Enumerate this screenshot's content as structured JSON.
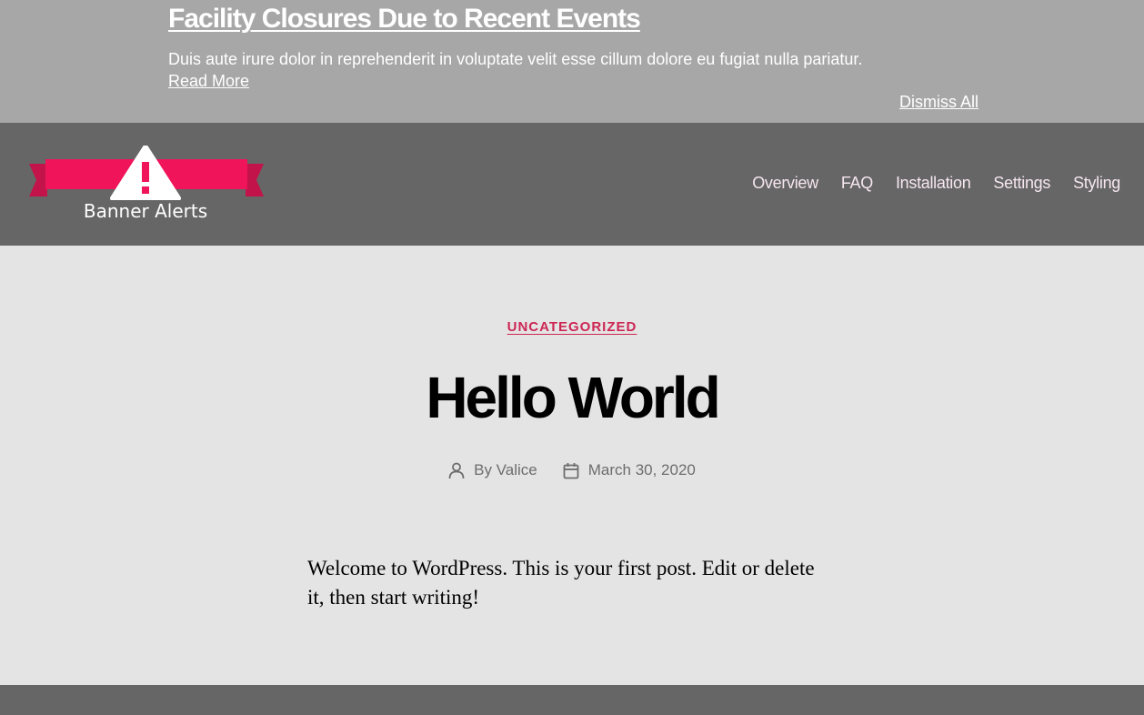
{
  "alert": {
    "title": "Facility Closures Due to Recent Events",
    "body": "Duis aute irure dolor in reprehenderit in voluptate velit esse cillum dolore eu fugiat nulla pariatur.",
    "read_more": "Read More",
    "dismiss_all": "Dismiss All"
  },
  "header": {
    "logo_text": "Banner Alerts",
    "nav": [
      "Overview",
      "FAQ",
      "Installation",
      "Settings",
      "Styling"
    ]
  },
  "post": {
    "category": "UNCATEGORIZED",
    "title": "Hello World",
    "author": "By Valice",
    "date": "March 30, 2020",
    "content": "Welcome to WordPress. This is your first post. Edit or delete it, then start writing!"
  },
  "colors": {
    "alert_bg": "#a7a7a7",
    "header_bg": "#666666",
    "page_bg": "#e4e4e4",
    "accent": "#cd2653",
    "logo_ribbon": "#f0145a"
  }
}
